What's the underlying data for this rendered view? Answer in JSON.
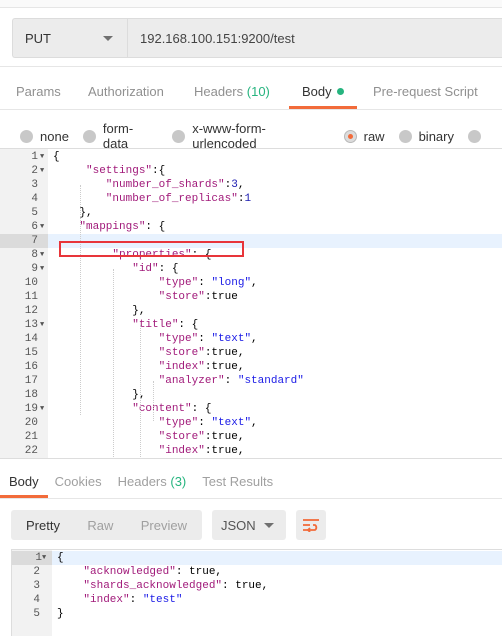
{
  "request": {
    "method": "PUT",
    "url": "192.168.100.151:9200/test"
  },
  "request_tabs": [
    {
      "label": "Params"
    },
    {
      "label": "Authorization"
    },
    {
      "label": "Headers",
      "count": "(10)"
    },
    {
      "label": "Body",
      "active": true,
      "dot": true
    },
    {
      "label": "Pre-request Script"
    }
  ],
  "body_types": [
    {
      "label": "none"
    },
    {
      "label": "form-data"
    },
    {
      "label": "x-www-form-urlencoded"
    },
    {
      "label": "raw",
      "selected": true
    },
    {
      "label": "binary"
    },
    {
      "label": ""
    }
  ],
  "editor_lines": [
    [
      [
        "p",
        "{"
      ]
    ],
    [
      [
        "k",
        "     \"settings\""
      ],
      [
        "p",
        ":{"
      ]
    ],
    [
      [
        "k",
        "        \"number_of_shards\""
      ],
      [
        "p",
        ":"
      ],
      [
        "n",
        "3"
      ],
      [
        "p",
        ","
      ]
    ],
    [
      [
        "k",
        "        \"number_of_replicas\""
      ],
      [
        "p",
        ":"
      ],
      [
        "n",
        "1"
      ]
    ],
    [
      [
        "p",
        "    },"
      ]
    ],
    [
      [
        "k",
        "    \"mappings\""
      ],
      [
        "p",
        ": {"
      ]
    ],
    [
      [
        "p",
        ""
      ]
    ],
    [
      [
        "k",
        "         \"properties\""
      ],
      [
        "p",
        ": {"
      ]
    ],
    [
      [
        "k",
        "            \"id\""
      ],
      [
        "p",
        ": {"
      ]
    ],
    [
      [
        "k",
        "                \"type\""
      ],
      [
        "p",
        ": "
      ],
      [
        "s",
        "\"long\""
      ],
      [
        "p",
        ","
      ]
    ],
    [
      [
        "k",
        "                \"store\""
      ],
      [
        "p",
        ":true"
      ]
    ],
    [
      [
        "p",
        "            },"
      ]
    ],
    [
      [
        "k",
        "            \"title\""
      ],
      [
        "p",
        ": {"
      ]
    ],
    [
      [
        "k",
        "                \"type\""
      ],
      [
        "p",
        ": "
      ],
      [
        "s",
        "\"text\""
      ],
      [
        "p",
        ","
      ]
    ],
    [
      [
        "k",
        "                \"store\""
      ],
      [
        "p",
        ":true,"
      ]
    ],
    [
      [
        "k",
        "                \"index\""
      ],
      [
        "p",
        ":true,"
      ]
    ],
    [
      [
        "k",
        "                \"analyzer\""
      ],
      [
        "p",
        ": "
      ],
      [
        "s",
        "\"standard\""
      ]
    ],
    [
      [
        "p",
        "            },"
      ]
    ],
    [
      [
        "k",
        "            \"content\""
      ],
      [
        "p",
        ": {"
      ]
    ],
    [
      [
        "k",
        "                \"type\""
      ],
      [
        "p",
        ": "
      ],
      [
        "s",
        "\"text\""
      ],
      [
        "p",
        ","
      ]
    ],
    [
      [
        "k",
        "                \"store\""
      ],
      [
        "p",
        ":true,"
      ]
    ],
    [
      [
        "k",
        "                \"index\""
      ],
      [
        "p",
        ":true,"
      ]
    ]
  ],
  "editor_fold_lines": [
    1,
    2,
    6,
    8,
    9,
    13,
    19
  ],
  "editor_highlight_line": 7,
  "response_tabs": [
    {
      "label": "Body",
      "active": true
    },
    {
      "label": "Cookies"
    },
    {
      "label": "Headers",
      "count": "(3)"
    },
    {
      "label": "Test Results"
    }
  ],
  "response_toolbar": {
    "views": [
      "Pretty",
      "Raw",
      "Preview"
    ],
    "active_view": "Pretty",
    "format": "JSON",
    "wrap_icon": "wrap-lines-icon"
  },
  "response_lines": [
    [
      [
        "p",
        "{"
      ]
    ],
    [
      [
        "k",
        "    \"acknowledged\""
      ],
      [
        "p",
        ": true,"
      ]
    ],
    [
      [
        "k",
        "    \"shards_acknowledged\""
      ],
      [
        "p",
        ": true,"
      ]
    ],
    [
      [
        "k",
        "    \"index\""
      ],
      [
        "p",
        ": "
      ],
      [
        "s",
        "\"test\""
      ]
    ],
    [
      [
        "p",
        "}"
      ]
    ]
  ],
  "response_fold_lines": [
    1
  ],
  "response_highlight_line": 1,
  "colors": {
    "accent": "#f26b3a",
    "green": "#26b47f",
    "annotation": "#e8353a"
  }
}
